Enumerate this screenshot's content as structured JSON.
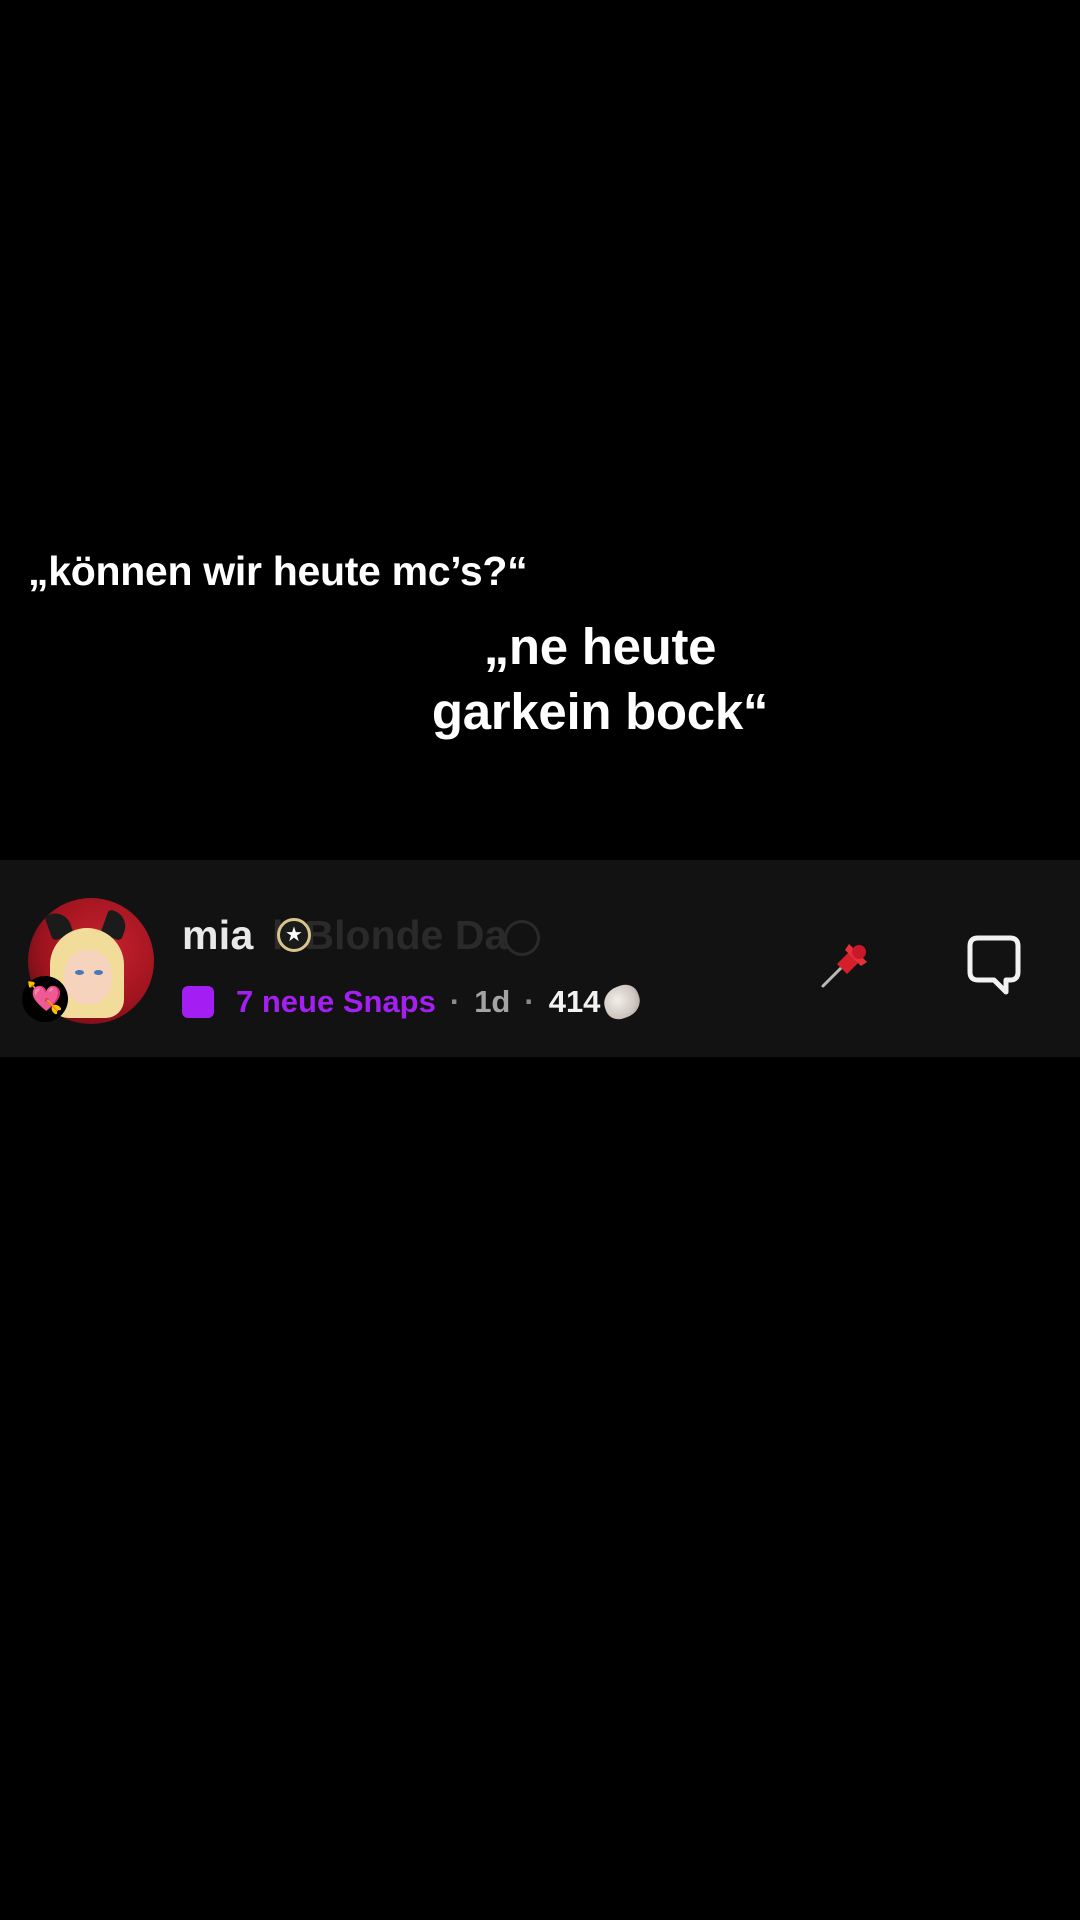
{
  "overlay_text": {
    "line1": "„können wir heute mc’s?“",
    "line2": "„ne heute garkein bock“"
  },
  "chat_row": {
    "name": "mia",
    "ghost_name": "l' Blonde Da",
    "status": {
      "snaps_label": "7 neue Snaps",
      "separator": "·",
      "time": "1d",
      "streak_count": "414"
    },
    "avatar_badge": "💘",
    "colors": {
      "snap_purple": "#a21ef2",
      "row_background": "#121212",
      "pin_red": "#d51f2b"
    },
    "icons": [
      "pin-icon",
      "chat-bubble-icon",
      "star-badge-icon",
      "shell-icon"
    ]
  }
}
